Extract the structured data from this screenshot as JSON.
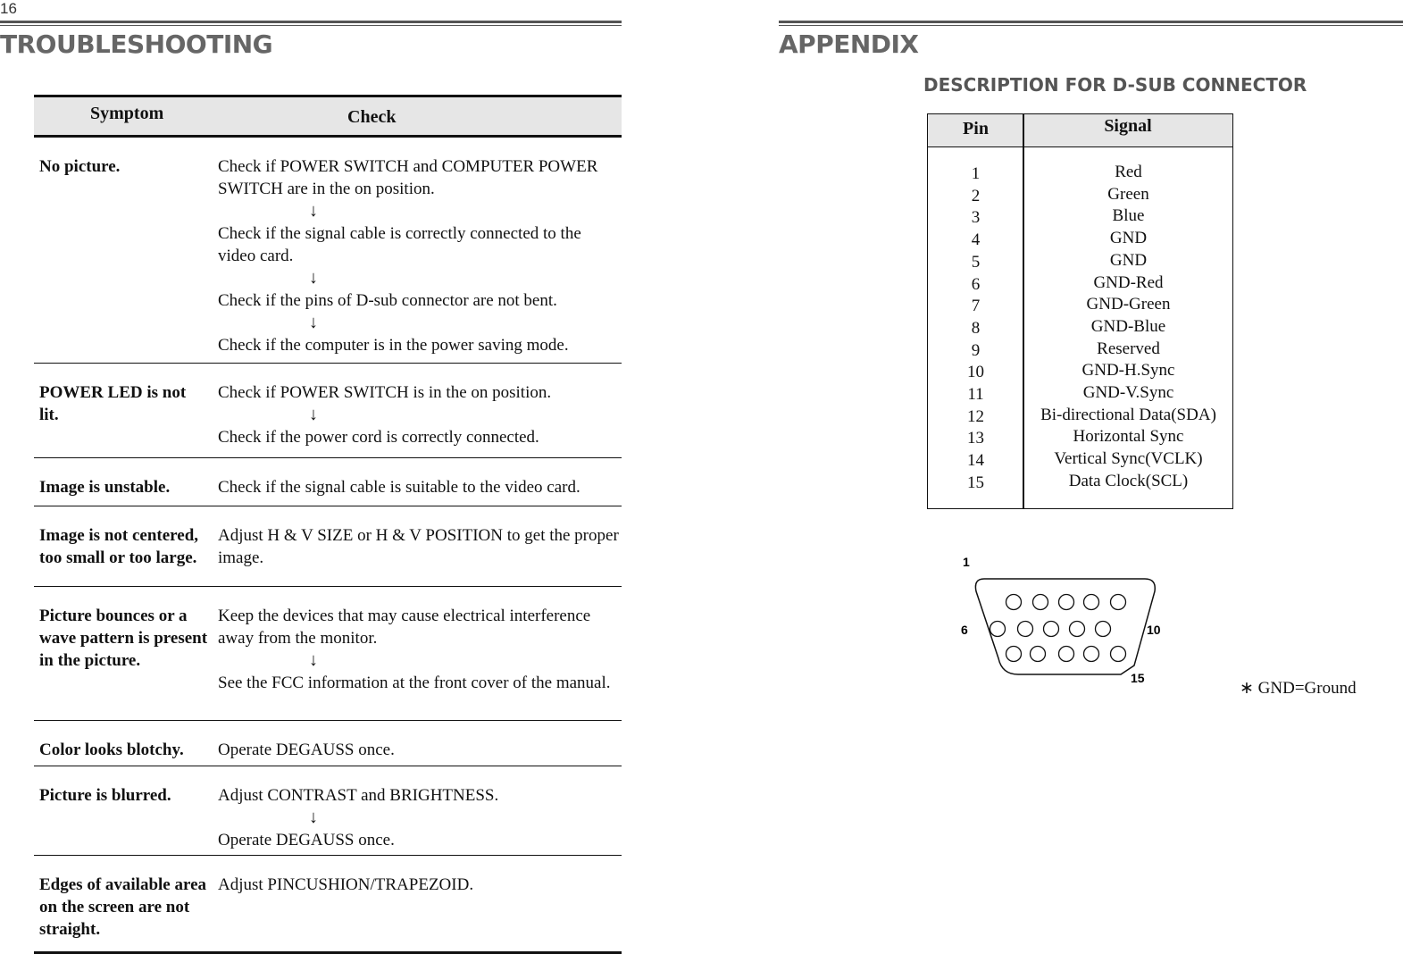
{
  "left_page": {
    "page_number": "16",
    "title": "TROUBLESHOOTING",
    "table": {
      "headers": {
        "symptom": "Symptom",
        "check": "Check"
      },
      "rows": [
        {
          "symptom": "No picture.",
          "checks": [
            "Check if POWER SWITCH and COMPUTER POWER SWITCH are in the on position.",
            "Check if the signal cable is correctly connected to the video card.",
            "Check if the pins of D-sub connector are not bent.",
            "Check if the computer is in the power saving mode."
          ]
        },
        {
          "symptom": "POWER LED is not lit.",
          "checks": [
            "Check if POWER SWITCH is in the on position.",
            "Check if the power cord is correctly connected."
          ]
        },
        {
          "symptom": "Image is unstable.",
          "checks": [
            "Check if the signal cable is suitable to the video card."
          ]
        },
        {
          "symptom": "Image is not centered, too small or too large.",
          "checks": [
            "Adjust H & V SIZE or H & V POSITION to get the proper image."
          ]
        },
        {
          "symptom": "Picture bounces or a wave pattern is present in the picture.",
          "checks": [
            "Keep the devices that may cause electrical interference away from the monitor.",
            "See the FCC information at the front cover of the manual."
          ]
        },
        {
          "symptom": "Color looks blotchy.",
          "checks": [
            "Operate DEGAUSS once."
          ]
        },
        {
          "symptom": "Picture is blurred.",
          "checks": [
            "Adjust CONTRAST and BRIGHTNESS.",
            "Operate DEGAUSS once."
          ]
        },
        {
          "symptom": "Edges of available area on the screen are not straight.",
          "checks": [
            "Adjust PINCUSHION/TRAPEZOID."
          ]
        }
      ],
      "step_arrow_icon": "down-arrow-icon"
    }
  },
  "right_page": {
    "title": "APPENDIX",
    "subtitle": "DESCRIPTION FOR D-SUB CONNECTOR",
    "pin_table": {
      "headers": {
        "pin": "Pin",
        "signal": "Signal"
      },
      "pins": [
        "1",
        "2",
        "3",
        "4",
        "5",
        "6",
        "7",
        "8",
        "9",
        "10",
        "11",
        "12",
        "13",
        "14",
        "15"
      ],
      "signals": [
        "Red",
        "Green",
        "Blue",
        "GND",
        "GND",
        "GND-Red",
        "GND-Green",
        "GND-Blue",
        "Reserved",
        "GND-H.Sync",
        "GND-V.Sync",
        "Bi-directional Data(SDA)",
        "Horizontal Sync",
        "Vertical Sync(VCLK)",
        "Data Clock(SCL)"
      ]
    },
    "connector_labels": {
      "pin1": "1",
      "pin6": "6",
      "pin10": "10",
      "pin15": "15"
    },
    "note": {
      "symbol": "∗",
      "text": "GND=Ground"
    }
  }
}
